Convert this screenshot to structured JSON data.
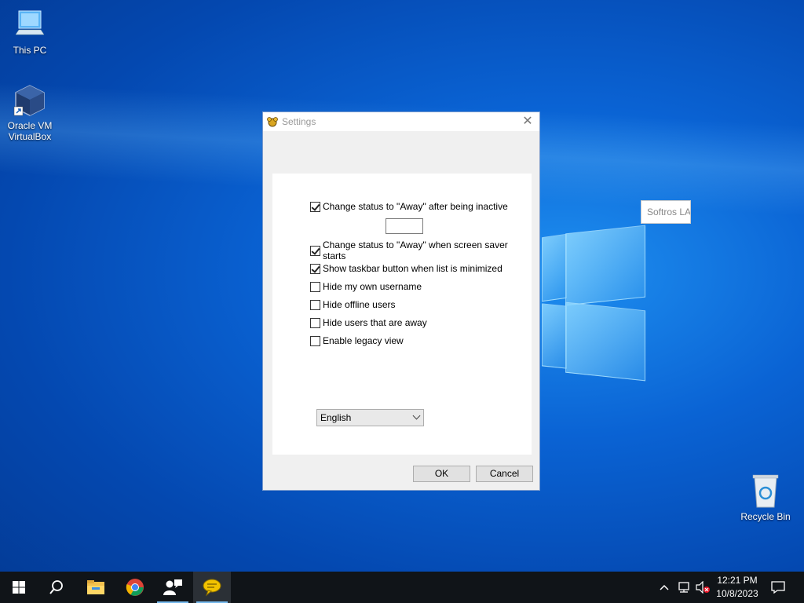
{
  "desktop": {
    "icons": [
      {
        "label": "This PC"
      },
      {
        "label": "Oracle VM VirtualBox"
      },
      {
        "label": "Recycle Bin"
      }
    ],
    "tooltip_text": "Softros LAN"
  },
  "dialog": {
    "title": "Settings",
    "options": [
      {
        "label": "Change status to \"Away\" after being inactive",
        "checked": true
      },
      {
        "label": "Change status to \"Away\" when screen saver starts",
        "checked": true
      },
      {
        "label": "Show taskbar button when list is minimized",
        "checked": true
      },
      {
        "label": "Hide my own username",
        "checked": false
      },
      {
        "label": "Hide offline users",
        "checked": false
      },
      {
        "label": "Hide users that are away",
        "checked": false
      },
      {
        "label": "Enable legacy view",
        "checked": false
      }
    ],
    "inactive_minutes_value": "",
    "language": "English",
    "ok_label": "OK",
    "cancel_label": "Cancel"
  },
  "taskbar": {
    "items": [
      "start-icon",
      "search-icon",
      "file-explorer-icon",
      "chrome-icon",
      "softros-users-icon",
      "softros-messenger-icon"
    ],
    "clock_time": "12:21 PM",
    "clock_date": "10/8/2023"
  },
  "colors": {
    "desktop_bg": "#0a63d4",
    "taskbar_bg": "#101418",
    "running_indicator": "#76b9ed"
  }
}
